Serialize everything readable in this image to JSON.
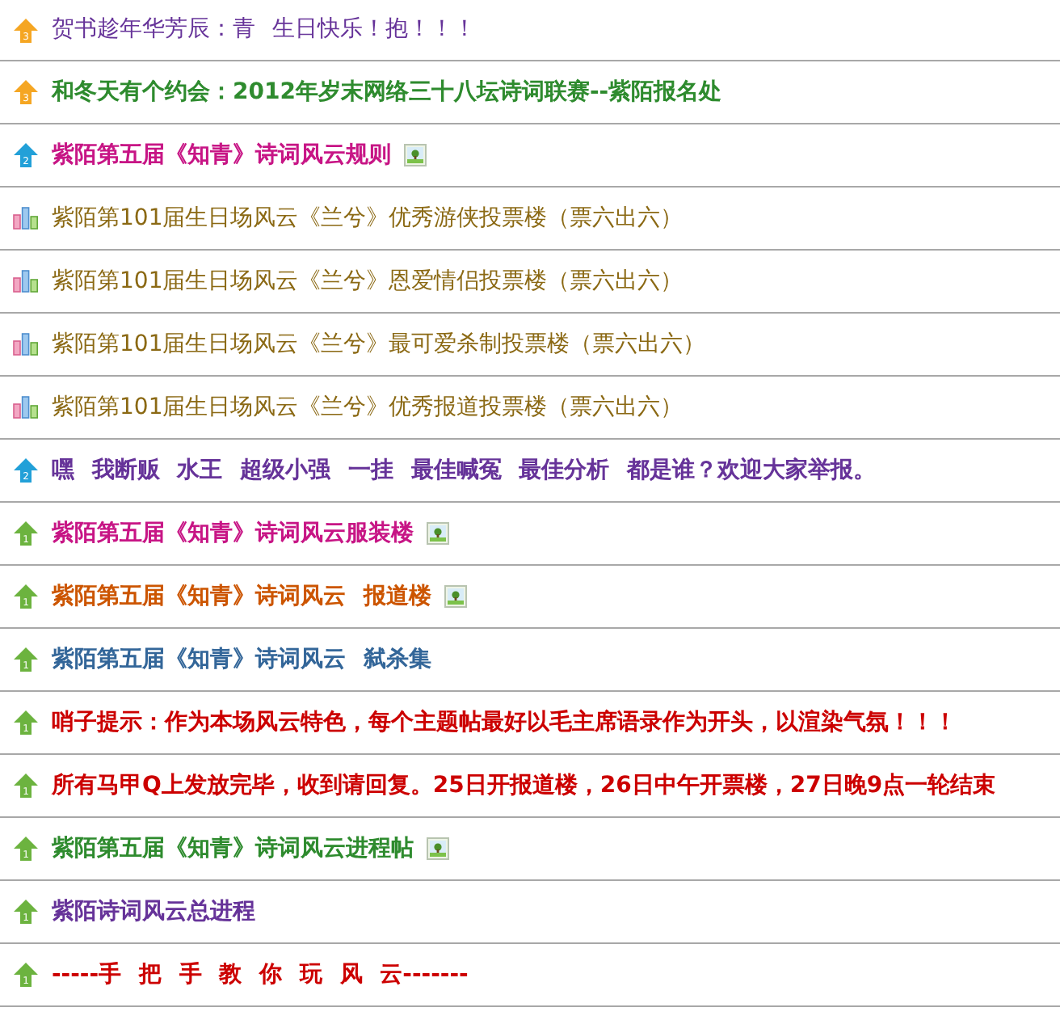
{
  "threads": [
    {
      "icon": {
        "kind": "arrow",
        "color": "#f5a623",
        "digit": "3"
      },
      "title": {
        "text": "贺书趁年华芳辰：青 生日快乐！抱！！！",
        "color": "#663399",
        "bold": false
      },
      "has_image": false
    },
    {
      "icon": {
        "kind": "arrow",
        "color": "#f5a623",
        "digit": "3"
      },
      "title": {
        "text": "和冬天有个约会：2012年岁末网络三十八坛诗词联赛--紫陌报名处",
        "color": "#2e8b2e",
        "bold": true
      },
      "has_image": false
    },
    {
      "icon": {
        "kind": "arrow",
        "color": "#22a0d8",
        "digit": "2"
      },
      "title": {
        "text": "紫陌第五届《知青》诗词风云规则",
        "color": "#c71585",
        "bold": true
      },
      "has_image": true
    },
    {
      "icon": {
        "kind": "poll"
      },
      "title": {
        "text": "紫陌第101届生日场风云《兰兮》优秀游侠投票楼（票六出六）",
        "color": "#8b6914",
        "bold": false
      },
      "has_image": false
    },
    {
      "icon": {
        "kind": "poll"
      },
      "title": {
        "text": "紫陌第101届生日场风云《兰兮》恩爱情侣投票楼（票六出六）",
        "color": "#8b6914",
        "bold": false
      },
      "has_image": false
    },
    {
      "icon": {
        "kind": "poll"
      },
      "title": {
        "text": "紫陌第101届生日场风云《兰兮》最可爱杀制投票楼（票六出六）",
        "color": "#8b6914",
        "bold": false
      },
      "has_image": false
    },
    {
      "icon": {
        "kind": "poll"
      },
      "title": {
        "text": "紫陌第101届生日场风云《兰兮》优秀报道投票楼（票六出六）",
        "color": "#8b6914",
        "bold": false
      },
      "has_image": false
    },
    {
      "icon": {
        "kind": "arrow",
        "color": "#22a0d8",
        "digit": "2"
      },
      "title": {
        "text": "嘿 我断贩 水王 超级小强 一挂 最佳喊冤 最佳分析 都是谁？欢迎大家举报。",
        "color": "#663399",
        "bold": true
      },
      "has_image": false
    },
    {
      "icon": {
        "kind": "arrow",
        "color": "#6cb33f",
        "digit": "1"
      },
      "title": {
        "text": "紫陌第五届《知青》诗词风云服装楼",
        "color": "#c71585",
        "bold": true
      },
      "has_image": true
    },
    {
      "icon": {
        "kind": "arrow",
        "color": "#6cb33f",
        "digit": "1"
      },
      "title": {
        "text": "紫陌第五届《知青》诗词风云 报道楼",
        "color": "#cc5500",
        "bold": true
      },
      "has_image": true
    },
    {
      "icon": {
        "kind": "arrow",
        "color": "#6cb33f",
        "digit": "1"
      },
      "title": {
        "text": "紫陌第五届《知青》诗词风云 弑杀集",
        "color": "#336699",
        "bold": true
      },
      "has_image": false
    },
    {
      "icon": {
        "kind": "arrow",
        "color": "#6cb33f",
        "digit": "1"
      },
      "title": {
        "text": "哨子提示：作为本场风云特色，每个主题帖最好以毛主席语录作为开头，以渲染气氛！！！",
        "color": "#cc0000",
        "bold": true
      },
      "has_image": false
    },
    {
      "icon": {
        "kind": "arrow",
        "color": "#6cb33f",
        "digit": "1"
      },
      "title": {
        "text": "所有马甲Q上发放完毕，收到请回复。25日开报道楼，26日中午开票楼，27日晚9点一轮结束",
        "color": "#cc0000",
        "bold": true
      },
      "has_image": false
    },
    {
      "icon": {
        "kind": "arrow",
        "color": "#6cb33f",
        "digit": "1"
      },
      "title": {
        "text": "紫陌第五届《知青》诗词风云进程帖",
        "color": "#2e8b2e",
        "bold": true
      },
      "has_image": true
    },
    {
      "icon": {
        "kind": "arrow",
        "color": "#6cb33f",
        "digit": "1"
      },
      "title": {
        "text": "紫陌诗词风云总进程",
        "color": "#663399",
        "bold": true
      },
      "has_image": false
    },
    {
      "icon": {
        "kind": "arrow",
        "color": "#6cb33f",
        "digit": "1"
      },
      "title": {
        "text": "-----手 把 手 教 你 玩 风 云-------",
        "color": "#cc0000",
        "bold": true
      },
      "has_image": false
    }
  ]
}
